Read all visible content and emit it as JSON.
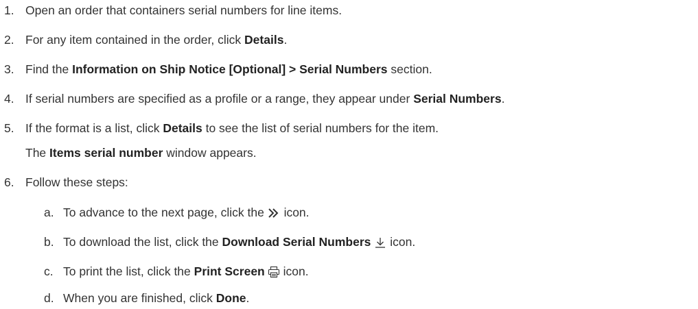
{
  "steps": [
    {
      "num": "1.",
      "pre": "Open an order that containers serial numbers for line items."
    },
    {
      "num": "2.",
      "pre": "For any item contained in the order, click ",
      "bold": "Details",
      "post": "."
    },
    {
      "num": "3.",
      "pre": "Find the ",
      "bold": "Information on Ship Notice [Optional] > Serial Numbers",
      "post": " section."
    },
    {
      "num": "4.",
      "pre": "If serial numbers are specified as a profile or a range, they appear under ",
      "bold": "Serial Numbers",
      "post": "."
    },
    {
      "num": "5.",
      "pre": "If the format is a list, click ",
      "bold": "Details",
      "post": " to see the list of serial numbers for the item.",
      "line2_pre": "The ",
      "line2_bold": "Items serial number",
      "line2_post": " window appears."
    },
    {
      "num": "6.",
      "pre": "Follow these steps:"
    }
  ],
  "substeps": [
    {
      "num": "a.",
      "pre": "To advance to the next page, click the ",
      "icon": "next-page-icon",
      "post": " icon."
    },
    {
      "num": "b.",
      "pre": "To download the list, click the ",
      "bold": "Download Serial Numbers",
      "icon": "download-icon",
      "post": " icon."
    },
    {
      "num": "c.",
      "pre": "To print the list, click the ",
      "bold": "Print Screen",
      "icon": "print-icon",
      "post": " icon."
    },
    {
      "num": "d.",
      "pre": "When you are finished, click ",
      "bold": "Done",
      "post": "."
    }
  ]
}
